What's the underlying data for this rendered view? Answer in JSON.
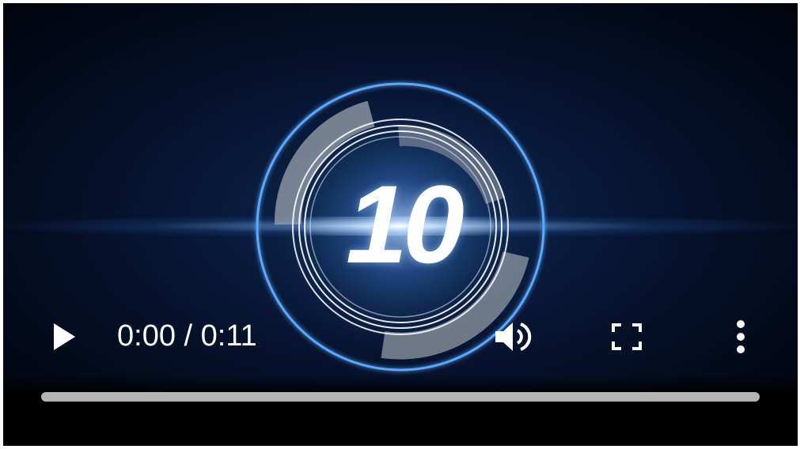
{
  "player": {
    "overlay_number": "10",
    "time": {
      "current": "0:00",
      "separator": " / ",
      "duration": "0:11"
    },
    "progress_fraction": 0.0,
    "controls": {
      "play_icon": "play-icon",
      "volume_icon": "volume-icon",
      "fullscreen_icon": "fullscreen-icon",
      "more_icon": "more-vertical-icon"
    },
    "colors": {
      "accent_ring": "#5aa8ff",
      "track": "#b4b4b4",
      "icon": "#ffffff"
    }
  }
}
